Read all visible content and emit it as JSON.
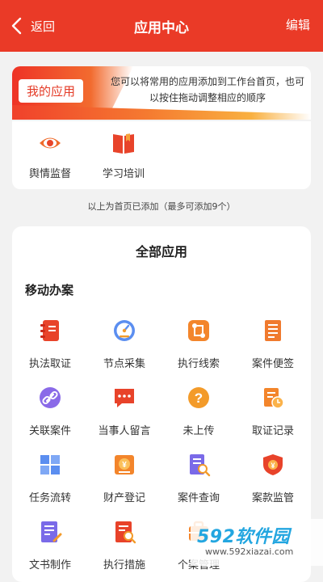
{
  "header": {
    "back_label": "返回",
    "title": "应用中心",
    "edit_label": "编辑"
  },
  "my_apps": {
    "tag": "我的应用",
    "description": "您可以将常用的应用添加到工作台首页，也可以按住拖动调整相应的顺序",
    "items": [
      {
        "label": "舆情监督",
        "icon": "eye-icon"
      },
      {
        "label": "学习培训",
        "icon": "book-icon"
      }
    ],
    "note": "以上为首页已添加（最多可添加9个）"
  },
  "all_apps": {
    "title": "全部应用",
    "section": "移动办案",
    "items": [
      {
        "label": "执法取证",
        "icon": "notebook-icon"
      },
      {
        "label": "节点采集",
        "icon": "gauge-icon"
      },
      {
        "label": "执行线索",
        "icon": "route-icon"
      },
      {
        "label": "案件便签",
        "icon": "notepad-icon"
      },
      {
        "label": "关联案件",
        "icon": "link-icon"
      },
      {
        "label": "当事人留言",
        "icon": "chat-icon"
      },
      {
        "label": "未上传",
        "icon": "question-icon"
      },
      {
        "label": "取证记录",
        "icon": "record-clock-icon"
      },
      {
        "label": "任务流转",
        "icon": "grid-icon"
      },
      {
        "label": "财产登记",
        "icon": "money-icon"
      },
      {
        "label": "案件查询",
        "icon": "search-doc-icon"
      },
      {
        "label": "案款监管",
        "icon": "shield-money-icon"
      },
      {
        "label": "文书制作",
        "icon": "doc-edit-icon"
      },
      {
        "label": "执行措施",
        "icon": "doc-search-icon"
      },
      {
        "label": "个案管理",
        "icon": "case-icon"
      },
      {
        "label": "",
        "icon": "blank"
      }
    ]
  },
  "watermark": {
    "logo": "592软件园",
    "url": "www.592xiazai.com"
  }
}
